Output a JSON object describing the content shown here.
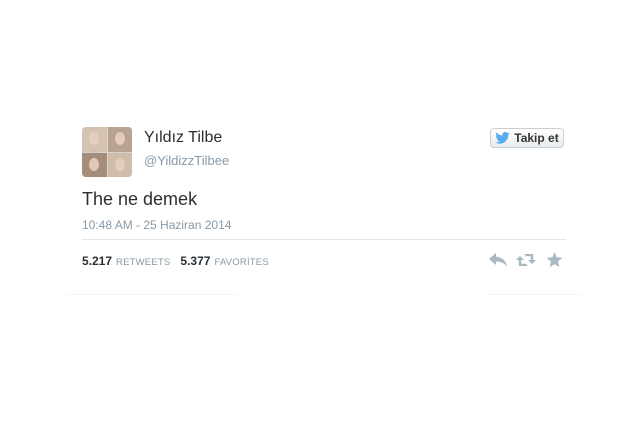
{
  "tweet": {
    "display_name": "Yıldız Tilbe",
    "handle": "@YildizzTilbee",
    "follow_label": "Takip et",
    "text": "The ne demek",
    "timestamp": "10:48 AM - 25 Haziran 2014",
    "retweet_count": "5.217",
    "retweet_label": "RETWEETS",
    "favorite_count": "5.377",
    "favorite_label": "FAVORİTES"
  },
  "icons": {
    "follow": "twitter-bird-icon",
    "reply": "reply-icon",
    "retweet": "retweet-icon",
    "favorite": "star-icon"
  },
  "colors": {
    "brand_bird": "#55acee",
    "muted_text": "#8899a6",
    "body_text": "#292f33",
    "action_icon": "#aab8c2"
  }
}
